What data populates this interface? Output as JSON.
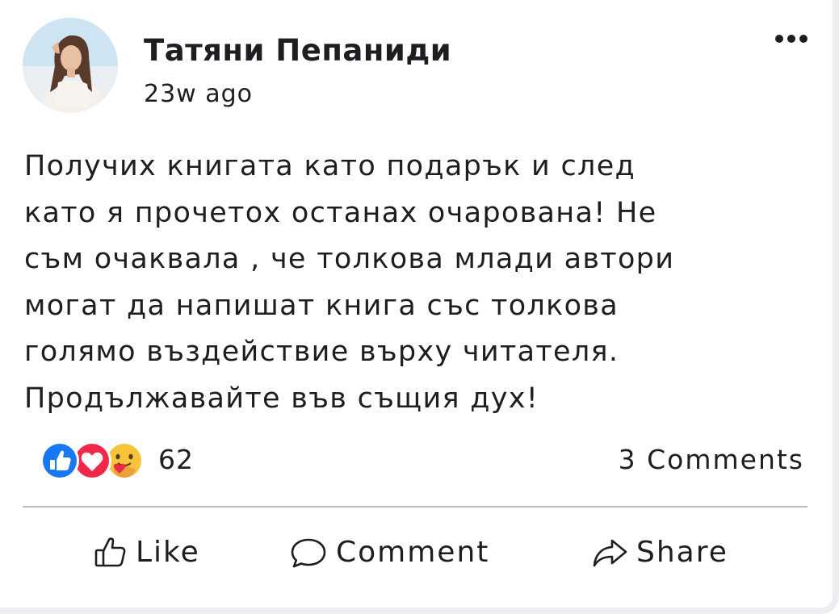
{
  "post": {
    "author": "Татяни Пепаниди",
    "timestamp": "23w ago",
    "body_lines": [
      "Получих книгата като подарък и след",
      "като я прочетох останах очарована! Не",
      "съм очаквала , че толкова млади автори",
      "могат да напишат книга със толкова",
      "голямо въздействие върху читателя.",
      "Продължавайте във същия дух!"
    ]
  },
  "stats": {
    "reaction_count": "62",
    "reaction_icons": [
      "like-icon",
      "love-icon",
      "care-icon"
    ],
    "comments": "3 Comments"
  },
  "actions": {
    "like": "Like",
    "comment": "Comment",
    "share": "Share"
  },
  "colors": {
    "like_blue": "#1877f2",
    "love_red": "#f0284a",
    "care_yellow": "#f7c43c",
    "divider": "#b8bcc2"
  }
}
